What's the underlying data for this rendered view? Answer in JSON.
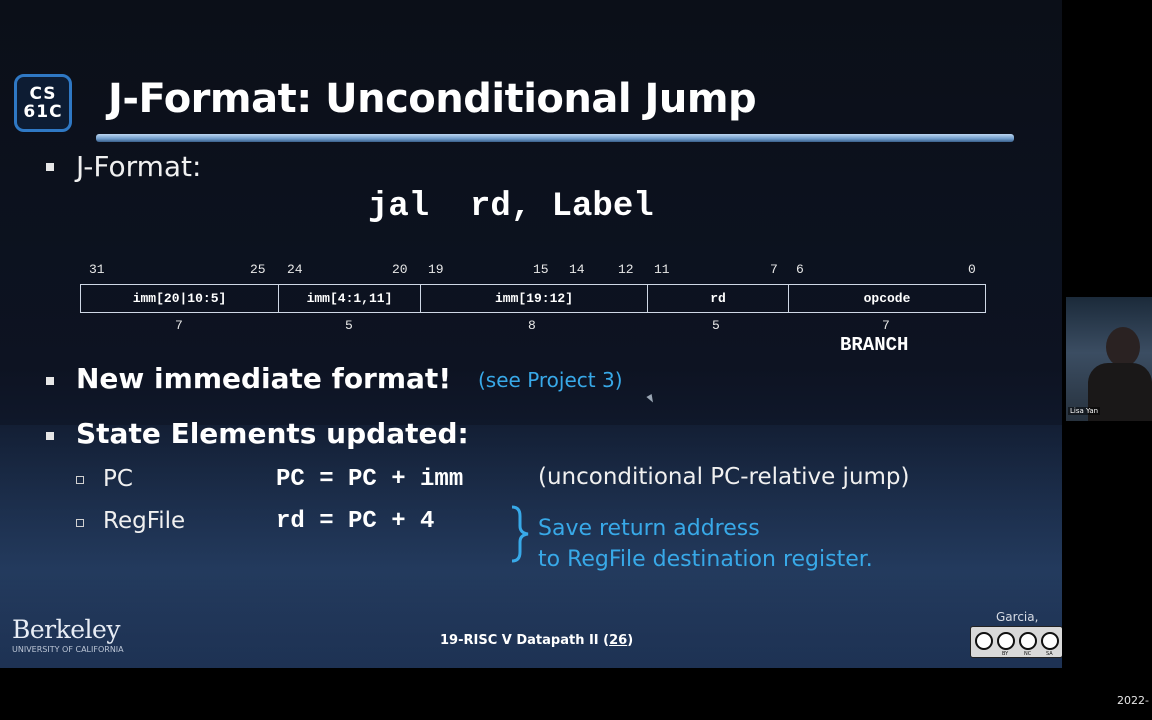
{
  "slide": {
    "logo_line1": "CS",
    "logo_line2": "61C",
    "title": "J-Format: Unconditional Jump",
    "bullet1": "J-Format:",
    "instruction": "jal  rd, Label",
    "format": {
      "bit_numbers": [
        "31",
        "25",
        "24",
        "20",
        "19",
        "15",
        "14",
        "12",
        "11",
        "7",
        "6",
        "0"
      ],
      "fields": [
        {
          "label": "imm[20|10:5]",
          "width": "7"
        },
        {
          "label": "imm[4:1,11]",
          "width": "5"
        },
        {
          "label": "imm[19:12]",
          "width": "8"
        },
        {
          "label": "rd",
          "width": "5"
        },
        {
          "label": "opcode",
          "width": "7"
        }
      ],
      "opcode_name": "BRANCH"
    },
    "bullet2": "New immediate format!",
    "bullet2_note": "(see Project 3)",
    "bullet3": "State Elements updated:",
    "sub_items": [
      {
        "label": "PC",
        "code": "PC = PC + imm",
        "desc": "(unconditional PC-relative jump)"
      },
      {
        "label": "RegFile",
        "code": "rd = PC + 4"
      }
    ],
    "save_line1": "Save return address",
    "save_line2": "to RegFile destination register.",
    "berkeley": "Berkeley",
    "berkeley_sub": "UNIVERSITY OF CALIFORNIA",
    "footer_prefix": "19-RISC V Datapath II (",
    "footer_page": "26",
    "footer_suffix": ")",
    "authors": "Garcia, Yan",
    "cc_labels": [
      "BY",
      "NC",
      "SA"
    ]
  },
  "webcam": {
    "name": "Lisa Yan"
  },
  "timestamp": "2022-"
}
